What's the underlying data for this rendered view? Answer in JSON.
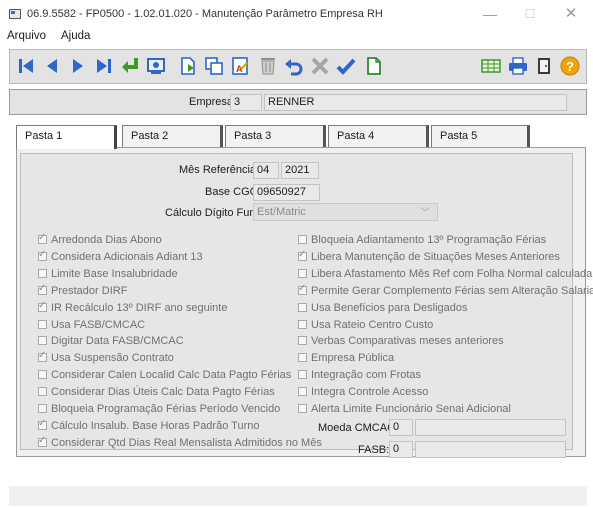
{
  "window": {
    "title": "06.9.5582 - FP0500 - 1.02.01.020 - Manutenção Parâmetro Empresa RH",
    "min_icon": "minimize-icon",
    "max_icon": "maximize-icon",
    "close_icon": "close-icon"
  },
  "menu": {
    "arquivo": "Arquivo",
    "ajuda": "Ajuda"
  },
  "toolbar": {
    "icons": [
      "first-record-icon",
      "previous-record-icon",
      "next-record-icon",
      "last-record-icon",
      "confirm-enter-icon",
      "view-record-icon",
      "new-record-icon",
      "copy-record-icon",
      "edit-record-icon",
      "delete-record-icon",
      "undo-icon",
      "cancel-icon",
      "save-check-icon",
      "document-icon",
      "table-icon",
      "print-icon",
      "exit-door-icon",
      "help-icon"
    ]
  },
  "empresa": {
    "label": "Empresa:",
    "code": "3",
    "name": "RENNER"
  },
  "tabs": [
    "Pasta 1",
    "Pasta 2",
    "Pasta 3",
    "Pasta 4",
    "Pasta 5"
  ],
  "form": {
    "mes_ref_label": "Mês Referência:",
    "mes": "04",
    "ano": "2021",
    "base_cgc_label": "Base CGC:",
    "base_cgc": "09650927",
    "calc_digito_label": "Cálculo Dígito Func:",
    "calc_digito_value": "Est/Matric",
    "moeda_label": "Moeda CMCAC:",
    "moeda_value": "0",
    "fasb_label": "FASB:",
    "fasb_value": "0"
  },
  "left_checks": [
    {
      "label": "Arredonda Dias Abono",
      "checked": true
    },
    {
      "label": "Considera Adicionais Adiant 13",
      "checked": true
    },
    {
      "label": "Limite Base Insalubridade",
      "checked": false
    },
    {
      "label": "Prestador DIRF",
      "checked": true
    },
    {
      "label": "IR Recálculo 13º DIRF ano seguinte",
      "checked": true
    },
    {
      "label": "Usa FASB/CMCAC",
      "checked": false
    },
    {
      "label": "Digitar Data FASB/CMCAC",
      "checked": false
    },
    {
      "label": "Usa Suspensão Contrato",
      "checked": true
    },
    {
      "label": "Considerar Calen Localid Calc Data Pagto Férias",
      "checked": false
    },
    {
      "label": "Considerar Dias Úteis Calc Data Pagto Férias",
      "checked": false
    },
    {
      "label": "Bloqueia Programação Férias Período Vencido",
      "checked": false
    },
    {
      "label": "Cálculo Insalub. Base Horas Padrão Turno",
      "checked": true
    },
    {
      "label": "Considerar Qtd Dias Real Mensalista Admitidos no Mês",
      "checked": true
    }
  ],
  "right_checks": [
    {
      "label": "Bloqueia Adiantamento 13º Programação Férias",
      "checked": false
    },
    {
      "label": "Libera Manutenção de Situações Meses Anteriores",
      "checked": true
    },
    {
      "label": "Libera Afastamento Mês Ref com Folha Normal calculada",
      "checked": false
    },
    {
      "label": "Permite Gerar Complemento Férias sem Alteração Salarial",
      "checked": true
    },
    {
      "label": "Usa Benefícios para Desligados",
      "checked": false
    },
    {
      "label": "Usa Rateio Centro Custo",
      "checked": false
    },
    {
      "label": "Verbas Comparativas meses anteriores",
      "checked": false
    },
    {
      "label": "Empresa Pública",
      "checked": false
    },
    {
      "label": "Integração com Frotas",
      "checked": false
    },
    {
      "label": "Integra Controle Acesso",
      "checked": false
    },
    {
      "label": "Alerta Limite Funcionário Senai Adicional",
      "checked": false
    }
  ]
}
